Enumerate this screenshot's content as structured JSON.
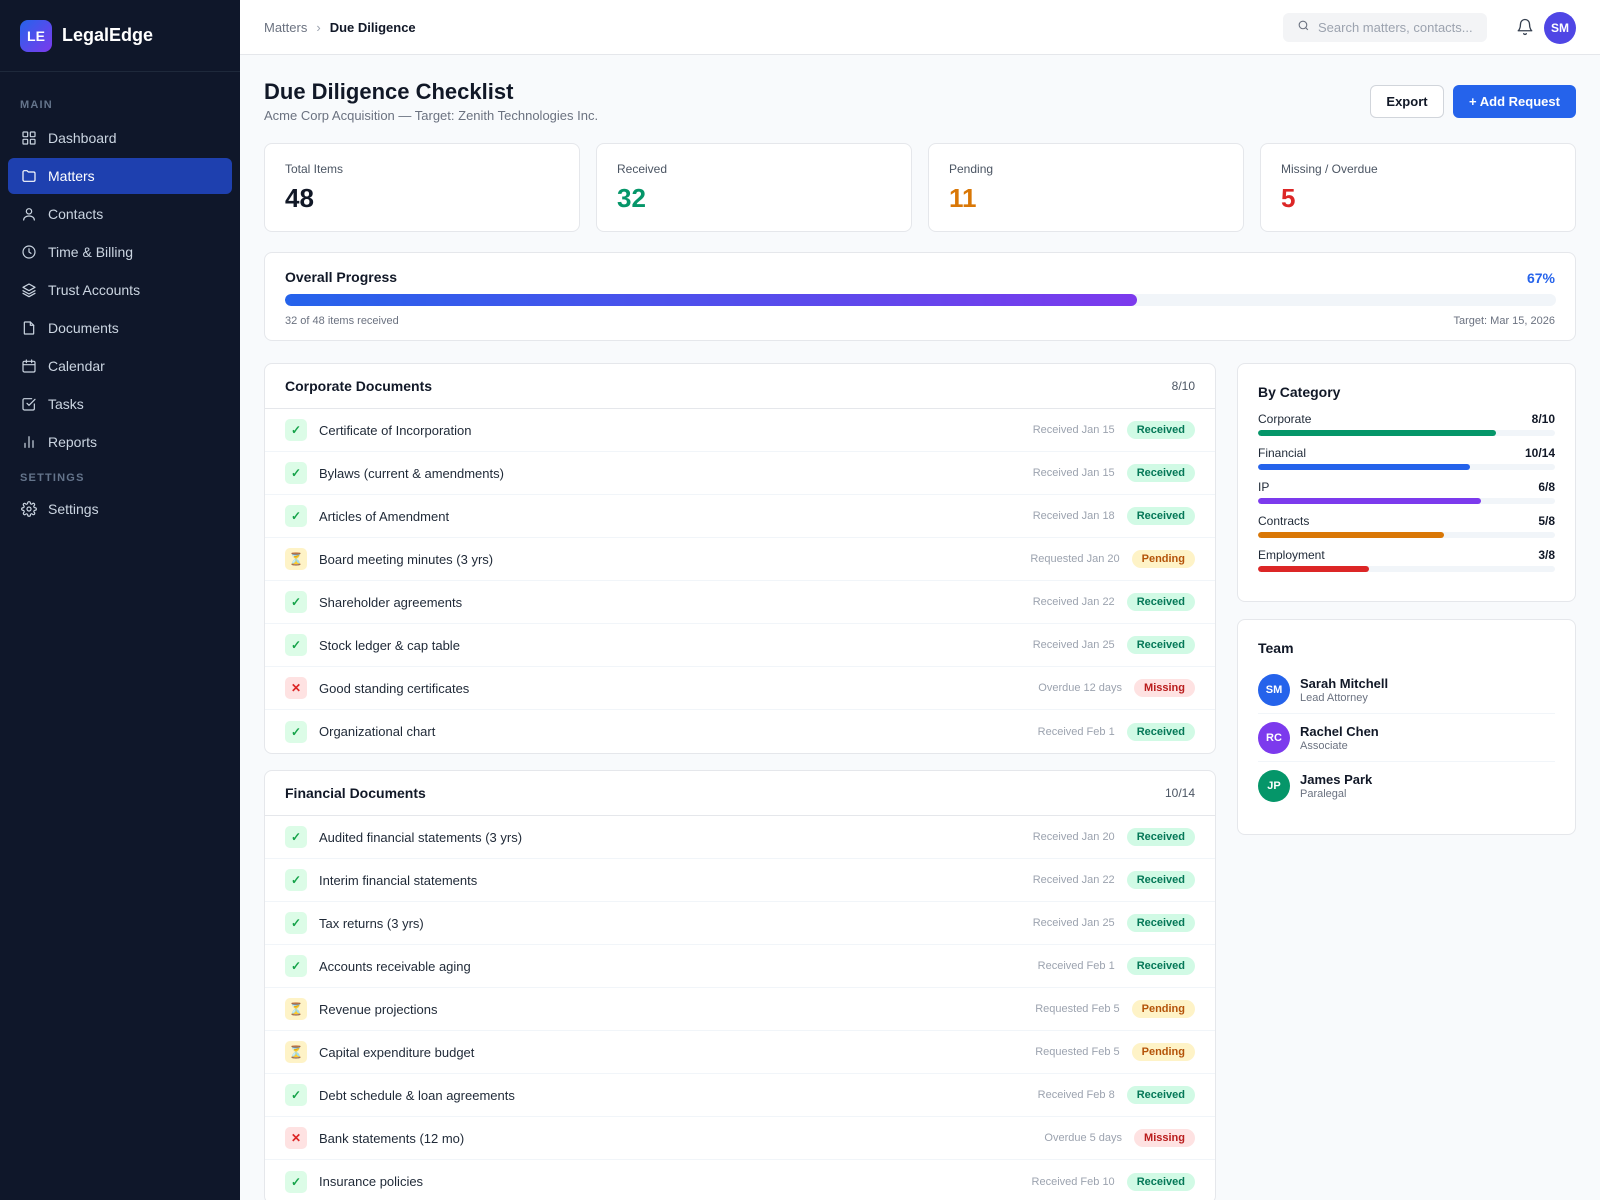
{
  "app": {
    "logo": "LE",
    "name": "LegalEdge"
  },
  "sidebar": {
    "section_main": "MAIN",
    "section_settings": "SETTINGS",
    "items": [
      {
        "label": "Dashboard",
        "icon": "grid-icon"
      },
      {
        "label": "Matters",
        "icon": "folder-icon",
        "active": true
      },
      {
        "label": "Contacts",
        "icon": "user-icon"
      },
      {
        "label": "Time & Billing",
        "icon": "clock-icon"
      },
      {
        "label": "Trust Accounts",
        "icon": "layers-icon"
      },
      {
        "label": "Documents",
        "icon": "file-icon"
      },
      {
        "label": "Calendar",
        "icon": "calendar-icon"
      },
      {
        "label": "Tasks",
        "icon": "check-square-icon"
      },
      {
        "label": "Reports",
        "icon": "bar-chart-icon"
      }
    ],
    "settings_item": {
      "label": "Settings",
      "icon": "gear-icon"
    }
  },
  "header": {
    "breadcrumb": [
      "Matters",
      "Due Diligence"
    ],
    "search_placeholder": "Search matters, contacts...",
    "avatar": "SM"
  },
  "page": {
    "title": "Due Diligence Checklist",
    "subtitle": "Acme Corp Acquisition — Target: Zenith Technologies Inc.",
    "export_label": "Export",
    "add_label": "+ Add Request"
  },
  "stats": [
    {
      "label": "Total Items",
      "value": "48",
      "color": "#111827"
    },
    {
      "label": "Received",
      "value": "32",
      "color": "#059669"
    },
    {
      "label": "Pending",
      "value": "11",
      "color": "#d97706"
    },
    {
      "label": "Missing / Overdue",
      "value": "5",
      "color": "#dc2626"
    }
  ],
  "progress": {
    "title": "Overall Progress",
    "percent_label": "67%",
    "fraction": 0.67,
    "note": "32 of 48 items received",
    "target": "Target: Mar 15, 2026"
  },
  "sections": [
    {
      "title": "Corporate Documents",
      "count": "8/10",
      "items": [
        {
          "name": "Certificate of Incorporation",
          "date": "Received Jan 15",
          "status": "received",
          "badge": "Received"
        },
        {
          "name": "Bylaws (current & amendments)",
          "date": "Received Jan 15",
          "status": "received",
          "badge": "Received"
        },
        {
          "name": "Articles of Amendment",
          "date": "Received Jan 18",
          "status": "received",
          "badge": "Received"
        },
        {
          "name": "Board meeting minutes (3 yrs)",
          "date": "Requested Jan 20",
          "status": "pending",
          "badge": "Pending"
        },
        {
          "name": "Shareholder agreements",
          "date": "Received Jan 22",
          "status": "received",
          "badge": "Received"
        },
        {
          "name": "Stock ledger & cap table",
          "date": "Received Jan 25",
          "status": "received",
          "badge": "Received"
        },
        {
          "name": "Good standing certificates",
          "date": "Overdue 12 days",
          "status": "missing",
          "badge": "Missing"
        },
        {
          "name": "Organizational chart",
          "date": "Received Feb 1",
          "status": "received",
          "badge": "Received"
        }
      ]
    },
    {
      "title": "Financial Documents",
      "count": "10/14",
      "items": [
        {
          "name": "Audited financial statements (3 yrs)",
          "date": "Received Jan 20",
          "status": "received",
          "badge": "Received"
        },
        {
          "name": "Interim financial statements",
          "date": "Received Jan 22",
          "status": "received",
          "badge": "Received"
        },
        {
          "name": "Tax returns (3 yrs)",
          "date": "Received Jan 25",
          "status": "received",
          "badge": "Received"
        },
        {
          "name": "Accounts receivable aging",
          "date": "Received Feb 1",
          "status": "received",
          "badge": "Received"
        },
        {
          "name": "Revenue projections",
          "date": "Requested Feb 5",
          "status": "pending",
          "badge": "Pending"
        },
        {
          "name": "Capital expenditure budget",
          "date": "Requested Feb 5",
          "status": "pending",
          "badge": "Pending"
        },
        {
          "name": "Debt schedule & loan agreements",
          "date": "Received Feb 8",
          "status": "received",
          "badge": "Received"
        },
        {
          "name": "Bank statements (12 mo)",
          "date": "Overdue 5 days",
          "status": "missing",
          "badge": "Missing"
        },
        {
          "name": "Insurance policies",
          "date": "Received Feb 10",
          "status": "received",
          "badge": "Received"
        }
      ]
    }
  ],
  "by_category": {
    "title": "By Category",
    "items": [
      {
        "label": "Corporate",
        "count": "8/10",
        "fraction": 0.8,
        "color": "#059669"
      },
      {
        "label": "Financial",
        "count": "10/14",
        "fraction": 0.714,
        "color": "#2563eb"
      },
      {
        "label": "IP",
        "count": "6/8",
        "fraction": 0.75,
        "color": "#7c3aed"
      },
      {
        "label": "Contracts",
        "count": "5/8",
        "fraction": 0.625,
        "color": "#d97706"
      },
      {
        "label": "Employment",
        "count": "3/8",
        "fraction": 0.375,
        "color": "#dc2626"
      }
    ]
  },
  "team": {
    "title": "Team",
    "members": [
      {
        "initials": "SM",
        "name": "Sarah Mitchell",
        "role": "Lead Attorney",
        "color": "#2563eb"
      },
      {
        "initials": "RC",
        "name": "Rachel Chen",
        "role": "Associate",
        "color": "#7c3aed"
      },
      {
        "initials": "JP",
        "name": "James Park",
        "role": "Paralegal",
        "color": "#059669"
      }
    ]
  }
}
